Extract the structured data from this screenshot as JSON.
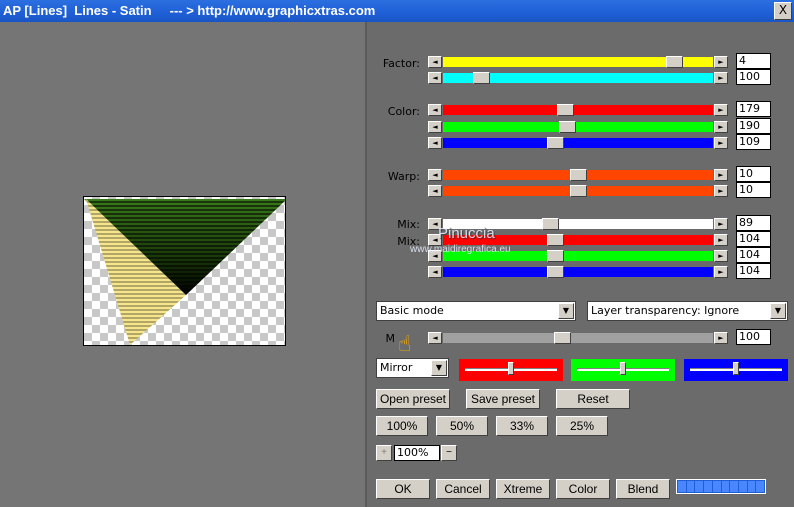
{
  "window": {
    "title": "AP [Lines]  Lines - Satin     --- > http://www.graphicxtras.com",
    "close_label": "X"
  },
  "sliders": {
    "factor_label": "Factor:",
    "factor": [
      {
        "value": "4",
        "fraction": 0.88,
        "color": "#ffff00"
      },
      {
        "value": "100",
        "fraction": 0.12,
        "color": "#00ffff"
      }
    ],
    "color_label": "Color:",
    "color": [
      {
        "value": "179",
        "fraction": 0.45,
        "color": "#ff0000"
      },
      {
        "value": "190",
        "fraction": 0.46,
        "color": "#00ff00"
      },
      {
        "value": "109",
        "fraction": 0.41,
        "color": "#0000ff"
      }
    ],
    "warp_label": "Warp:",
    "warp": [
      {
        "value": "10",
        "fraction": 0.5,
        "color": "#ff4500"
      },
      {
        "value": "10",
        "fraction": 0.5,
        "color": "#ff4500"
      }
    ],
    "mix_label": "Mix:",
    "mix2_label": "Mix:",
    "mix": [
      {
        "value": "89",
        "fraction": 0.39,
        "color": "#ffffff"
      },
      {
        "value": "104",
        "fraction": 0.41,
        "color": "#ff0000"
      },
      {
        "value": "104",
        "fraction": 0.41,
        "color": "#00ff00"
      },
      {
        "value": "104",
        "fraction": 0.41,
        "color": "#0000ff"
      }
    ],
    "m_label": "M",
    "m": {
      "value": "100",
      "fraction": 0.44,
      "color": "#a0a0a0"
    }
  },
  "mode_select": "Basic mode",
  "transparency_select": "Layer transparency: Ignore",
  "mirror_select": "Mirror",
  "buttons": {
    "open_preset": "Open preset",
    "save_preset": "Save preset",
    "reset": "Reset",
    "zoom100": "100%",
    "zoom50": "50%",
    "zoom33": "33%",
    "zoom25": "25%",
    "plus": "+",
    "zoom_value": "100%",
    "minus": "−",
    "ok": "OK",
    "cancel": "Cancel",
    "xtreme": "Xtreme",
    "color": "Color",
    "blend": "Blend"
  },
  "watermark": {
    "name": "Pinuccia",
    "url": "www.maidiregrafica.eu"
  }
}
